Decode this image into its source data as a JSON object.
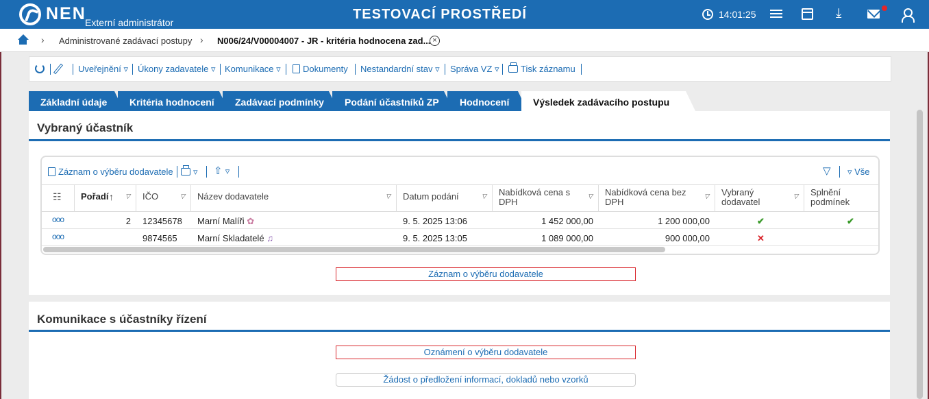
{
  "header": {
    "logo": "NEN",
    "subtitle": "Externí administrátor",
    "environment": "TESTOVACÍ PROSTŘEDÍ",
    "time": "14:01:25",
    "icons": [
      "clock-icon",
      "menu-icon",
      "calendar-icon",
      "download-icon",
      "mail-icon",
      "user-icon"
    ]
  },
  "breadcrumb": {
    "items": [
      "Administrované zadávací postupy",
      "N006/24/V00004007 - JR - kritéria hodnocena zad..."
    ]
  },
  "toolbar": {
    "publish": "Uveřejnění",
    "actions": "Úkony zadavatele",
    "communication": "Komunikace",
    "documents": "Dokumenty",
    "nonstandard": "Nestandardní stav",
    "management": "Správa VZ",
    "print": "Tisk záznamu"
  },
  "tabs": [
    "Základní údaje",
    "Kritéria hodnocení",
    "Zadávací podmínky",
    "Podání účastníků ZP",
    "Hodnocení",
    "Výsledek zadávacího postupu"
  ],
  "section1": {
    "title": "Vybraný účastník",
    "grid_toolbar": {
      "record": "Záznam o výběru dodavatele",
      "all": "Vše"
    },
    "columns": {
      "order": "Pořadí",
      "ico": "IČO",
      "name": "Název dodavatele",
      "date": "Datum podání",
      "price_vat": "Nabídková cena s DPH",
      "price_novat": "Nabídková cena bez DPH",
      "selected": "Vybraný dodavatel",
      "conditions": "Splnění podmínek"
    },
    "rows": [
      {
        "order": "2",
        "ico": "12345678",
        "name": "Marní Malíři",
        "date": "9. 5. 2025 13:06",
        "price_vat": "1 452 000,00",
        "price_novat": "1 200 000,00",
        "selected": "✔",
        "conditions": "✔"
      },
      {
        "order": "",
        "ico": "9874565",
        "name": "Marní Skladatelé",
        "date": "9. 5. 2025 13:05",
        "price_vat": "1 089 000,00",
        "price_novat": "900 000,00",
        "selected": "✕",
        "conditions": ""
      }
    ],
    "button": "Záznam o výběru dodavatele"
  },
  "section2": {
    "title": "Komunikace s účastníky řízení",
    "button1": "Oznámení o výběru dodavatele",
    "button2": "Žádost o předložení informací, dokladů nebo vzorků"
  },
  "colors": {
    "brand": "#1c6cb3",
    "ok": "#3a9a2a",
    "error": "#d9262c"
  }
}
